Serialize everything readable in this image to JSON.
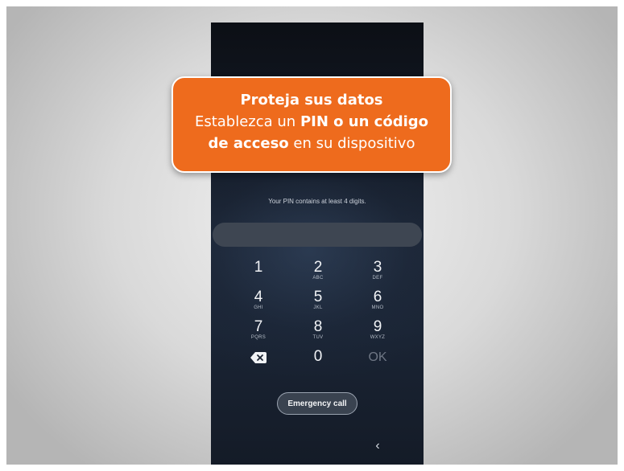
{
  "callout": {
    "title": "Proteja sus datos",
    "line2_prefix": "Establezca un ",
    "line2_bold": "PIN o un código",
    "line3_bold": "de acceso",
    "line3_suffix": " en su dispositivo"
  },
  "lock_screen": {
    "hint": "Your PIN contains at least 4 digits.",
    "pin_value": "",
    "keys": [
      {
        "digit": "1",
        "letters": ""
      },
      {
        "digit": "2",
        "letters": "ABC"
      },
      {
        "digit": "3",
        "letters": "DEF"
      },
      {
        "digit": "4",
        "letters": "GHI"
      },
      {
        "digit": "5",
        "letters": "JKL"
      },
      {
        "digit": "6",
        "letters": "MNO"
      },
      {
        "digit": "7",
        "letters": "PQRS"
      },
      {
        "digit": "8",
        "letters": "TUV"
      },
      {
        "digit": "9",
        "letters": "WXYZ"
      }
    ],
    "zero": "0",
    "ok": "OK",
    "backspace_icon": "backspace-icon",
    "emergency_call": "Emergency call",
    "nav_back": "‹"
  },
  "colors": {
    "callout_bg": "#ee6b1d",
    "phone_bg": "#141b27"
  }
}
